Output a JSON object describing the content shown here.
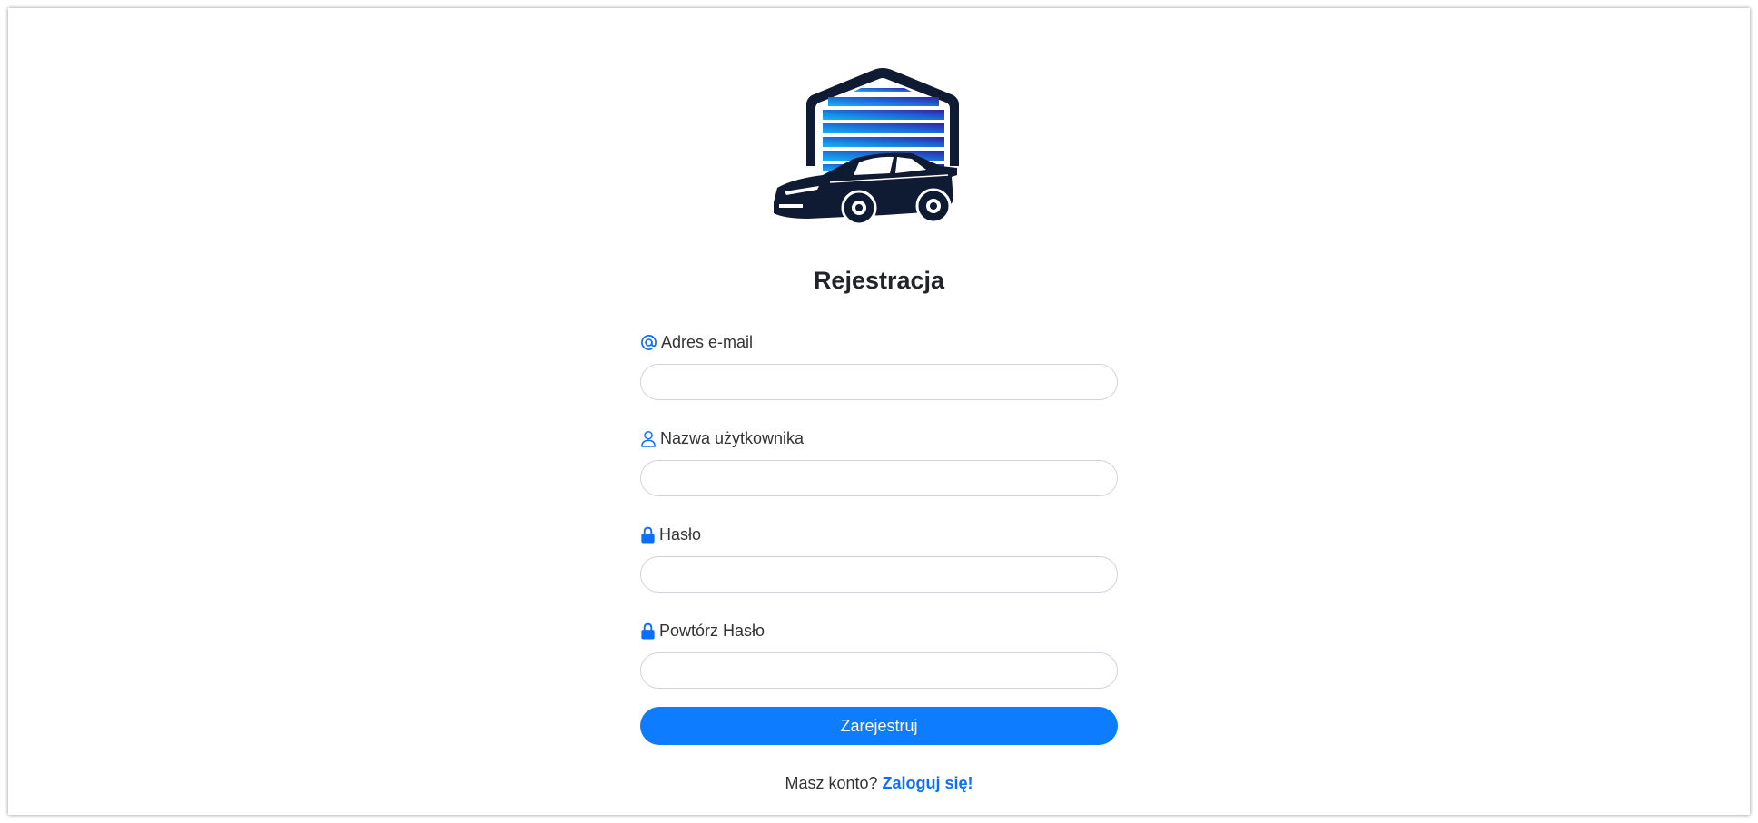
{
  "form": {
    "title": "Rejestracja",
    "email_label": "Adres e-mail",
    "email_value": "",
    "username_label": "Nazwa użytkownika",
    "username_value": "",
    "password_label": "Hasło",
    "password_value": "",
    "repeat_password_label": "Powtórz Hasło",
    "repeat_password_value": "",
    "submit_label": "Zarejestruj"
  },
  "footer": {
    "prompt": "Masz konto?",
    "login_link": "Zaloguj się!"
  },
  "colors": {
    "accent": "#0d7cff",
    "link": "#0d6efd",
    "logo_dark": "#0f1a33"
  },
  "icons": {
    "email": "at-icon",
    "username": "user-icon",
    "password": "lock-icon",
    "repeat_password": "lock-icon"
  }
}
